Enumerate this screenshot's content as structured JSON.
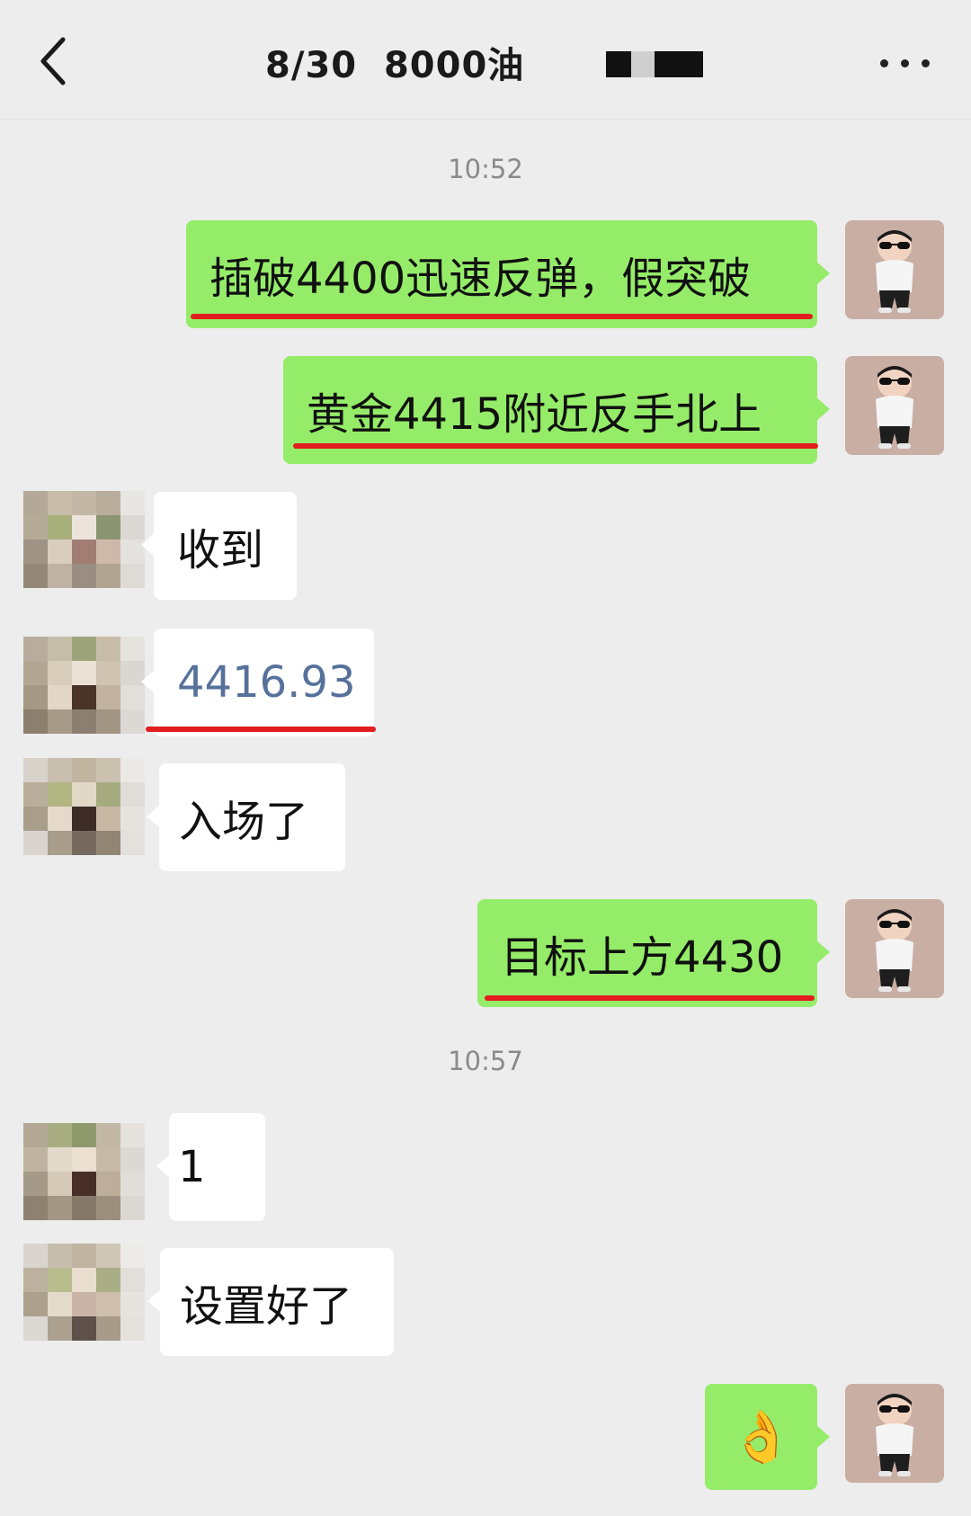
{
  "header": {
    "title": "8/30  8000油",
    "back_icon": "chevron-left-icon",
    "more_icon": "more-dots-icon"
  },
  "timestamps": [
    "10:52",
    "10:57"
  ],
  "messages": [
    {
      "side": "right",
      "text": "插破4400迅速反弹，假突破",
      "underlined": true
    },
    {
      "side": "right",
      "text": "黄金4415附近反手北上",
      "underlined": true
    },
    {
      "side": "left",
      "text": "收到",
      "underlined": false
    },
    {
      "side": "left",
      "text": "4416.93",
      "underlined": true,
      "style": "link"
    },
    {
      "side": "left",
      "text": "入场了",
      "underlined": false
    },
    {
      "side": "right",
      "text": "目标上方4430",
      "underlined": true
    },
    {
      "side": "left",
      "text": "1",
      "underlined": false
    },
    {
      "side": "left",
      "text": "设置好了",
      "underlined": false
    },
    {
      "side": "right",
      "emoji": "ok-hand-emoji",
      "text": "👌",
      "underlined": false
    }
  ],
  "colors": {
    "background": "#ededed",
    "green_bubble": "#95ec69",
    "white_bubble": "#ffffff",
    "underline": "#e21d1d",
    "link_text": "#56719b"
  }
}
